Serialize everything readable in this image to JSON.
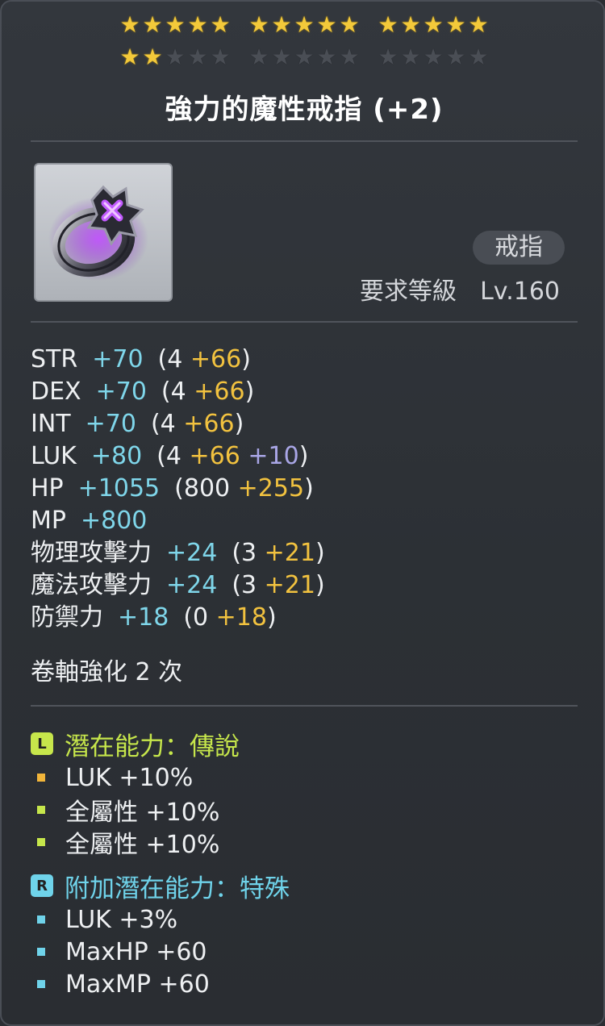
{
  "stars": {
    "filled": 17,
    "total": 30,
    "glyph": "★",
    "filled_color": "#f3c93a",
    "empty_color": "#4a4e55"
  },
  "item": {
    "name": "強力的魔性戒指 (+2)",
    "category": "戒指",
    "requirement_label": "要求等級",
    "requirement_level": "Lv.160",
    "icon": "purple-cursed-ring-icon"
  },
  "stats": [
    {
      "name": "STR",
      "total": "+70",
      "base": "4",
      "bonus": "+66",
      "extra": ""
    },
    {
      "name": "DEX",
      "total": "+70",
      "base": "4",
      "bonus": "+66",
      "extra": ""
    },
    {
      "name": "INT",
      "total": "+70",
      "base": "4",
      "bonus": "+66",
      "extra": ""
    },
    {
      "name": "LUK",
      "total": "+80",
      "base": "4",
      "bonus": "+66",
      "extra": "+10"
    },
    {
      "name": "HP",
      "total": "+1055",
      "base": "800",
      "bonus": "+255",
      "extra": ""
    },
    {
      "name": "MP",
      "total": "+800",
      "base": "",
      "bonus": "",
      "extra": ""
    },
    {
      "name": "物理攻擊力",
      "total": "+24",
      "base": "3",
      "bonus": "+21",
      "extra": ""
    },
    {
      "name": "魔法攻擊力",
      "total": "+24",
      "base": "3",
      "bonus": "+21",
      "extra": ""
    },
    {
      "name": "防禦力",
      "total": "+18",
      "base": "0",
      "bonus": "+18",
      "extra": ""
    }
  ],
  "scroll_upgrades": "卷軸強化 2 次",
  "potential": {
    "badge": "L",
    "label": "潛在能力：傳說",
    "color": "#c6e64b",
    "lines": [
      {
        "text": "LUK +10%",
        "bullet_color": "#f2b53a"
      },
      {
        "text": "全屬性 +10%",
        "bullet_color": "#c6e64b"
      },
      {
        "text": "全屬性 +10%",
        "bullet_color": "#c6e64b"
      }
    ]
  },
  "additional_potential": {
    "badge": "R",
    "label": "附加潛在能力：特殊",
    "color": "#6fd3ea",
    "lines": [
      {
        "text": "LUK +3%",
        "bullet_color": "#6fd3ea"
      },
      {
        "text": "MaxHP +60",
        "bullet_color": "#6fd3ea"
      },
      {
        "text": "MaxMP +60",
        "bullet_color": "#6fd3ea"
      }
    ]
  },
  "colors": {
    "stat_total": "#7fd6ea",
    "stat_bonus": "#f2c23f",
    "stat_extra": "#a9a6e6"
  }
}
